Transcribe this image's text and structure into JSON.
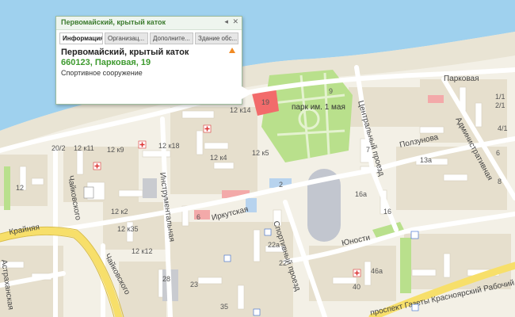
{
  "popup": {
    "title": "Первомайский, крытый каток",
    "tabs": [
      "Информация",
      "Организац...",
      "Дополните...",
      "Здание обс..."
    ],
    "name": "Первомайский, крытый каток",
    "address": "660123, Парковая, 19",
    "category": "Спортивное сооружение",
    "controls": [
      "pin-icon",
      "close-icon"
    ]
  },
  "streets": {
    "parkovaya": "Парковая",
    "polzunova": "Ползунова",
    "centralny": "Центральный проезд",
    "administrativnaya": "Административная",
    "irkutskaya": "Иркутская",
    "instrumentalnaya": "Инструментальная",
    "sportivny": "Спортивный проезд",
    "yunosti": "Юности",
    "krainyaya": "Крайняя",
    "chaikovskogo": "Чайковского",
    "chaikovskogo2": "Чайковского",
    "astrakhanskaya": "Астраханская",
    "prospekt": "проспект Газеты Красноярский Рабочий"
  },
  "park": {
    "name": "парк им. 1 мая"
  },
  "buildings": [
    "19",
    "9",
    "12 к14",
    "12 к18",
    "12 к9",
    "12 к4",
    "12 к5",
    "20/2",
    "12 к2",
    "12 к35",
    "12 к12",
    "12 к11",
    "7",
    "13а",
    "16а",
    "16",
    "2",
    "6",
    "28",
    "22а",
    "22",
    "46а",
    "40",
    "23",
    "35",
    "12",
    "1/1",
    "2/1",
    "4/1",
    "6",
    "8"
  ],
  "colors": {
    "water": "#9fd1ee",
    "park": "#b9e08c",
    "stadium": "#c2c6cf",
    "highlight": "#f26b6b",
    "road_main": "#f7df6a",
    "ground": "#f3f0e6",
    "block": "#e6dfcd"
  }
}
